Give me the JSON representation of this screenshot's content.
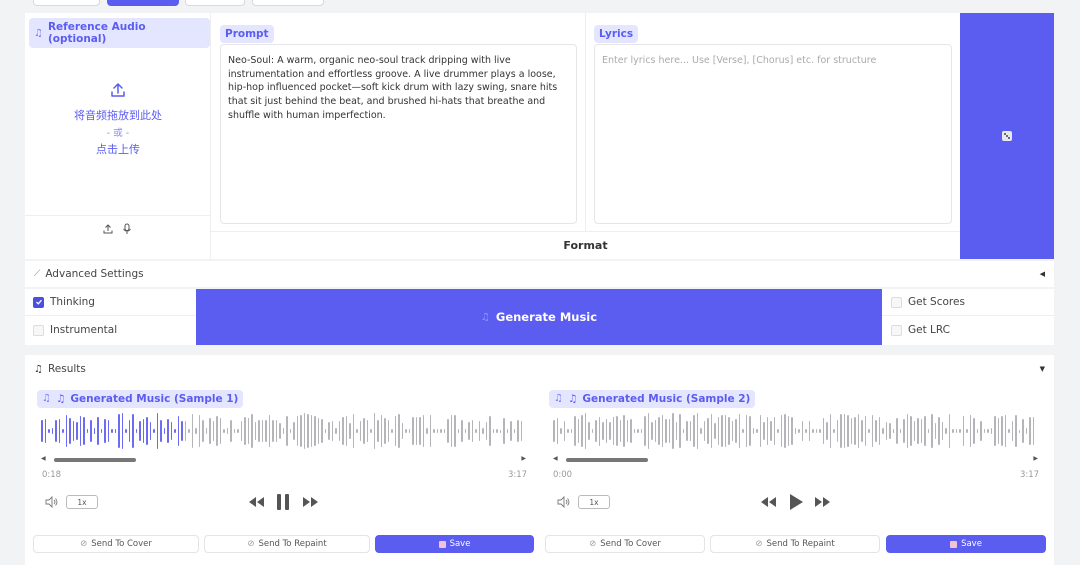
{
  "reference": {
    "label": "Reference Audio (optional)",
    "drop_text": "将音频拖放到此处",
    "or_text": "- 或 -",
    "click_text": "点击上传"
  },
  "prompt": {
    "label": "Prompt",
    "value": "Neo-Soul: A warm, organic neo-soul track dripping with live instrumentation and effortless groove. A live drummer plays a loose, hip-hop influenced pocket—soft kick drum with lazy swing, snare hits that sit just behind the beat, and brushed hi-hats that breathe and shuffle with human imperfection."
  },
  "lyrics": {
    "label": "Lyrics",
    "placeholder": "Enter lyrics here... Use [Verse], [Chorus] etc. for structure"
  },
  "format_label": "Format",
  "advanced_label": "Advanced Settings",
  "options": {
    "thinking": "Thinking",
    "instrumental": "Instrumental",
    "get_scores": "Get Scores",
    "get_lrc": "Get LRC"
  },
  "generate_label": "Generate Music",
  "results": {
    "label": "Results",
    "samples": [
      {
        "title": "Generated Music (Sample 1)",
        "current": "0:18",
        "duration": "3:17",
        "speed": "1x",
        "progress": 0.088,
        "send_cover": "Send To Cover",
        "send_repaint": "Send To Repaint",
        "save": "Save"
      },
      {
        "title": "Generated Music (Sample 2)",
        "current": "0:00",
        "duration": "3:17",
        "speed": "1x",
        "progress": 0,
        "send_cover": "Send To Cover",
        "send_repaint": "Send To Repaint",
        "save": "Save"
      }
    ]
  },
  "colors": {
    "accent": "#5b5cf0",
    "accent_light": "#e4e6ff",
    "wave_played": "#6b6cf2",
    "wave_unplayed": "#b5b5b9"
  }
}
